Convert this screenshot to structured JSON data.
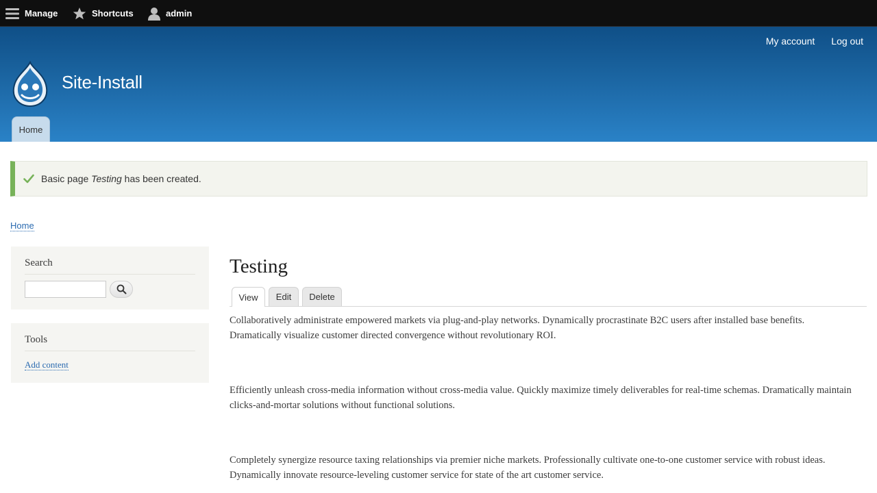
{
  "toolbar": {
    "manage": "Manage",
    "shortcuts": "Shortcuts",
    "user": "admin"
  },
  "header": {
    "secondary_menu": [
      "My account",
      "Log out"
    ],
    "site_name": "Site-Install",
    "main_tab": "Home",
    "brand_color": "#2a82c7"
  },
  "status": {
    "prefix": "Basic page ",
    "title": "Testing",
    "suffix": " has been created.",
    "accent_color": "#77b259"
  },
  "breadcrumb": "Home",
  "sidebar": {
    "search_title": "Search",
    "search_value": "",
    "tools_title": "Tools",
    "tools_link": "Add content"
  },
  "main": {
    "title": "Testing",
    "tabs": [
      "View",
      "Edit",
      "Delete"
    ],
    "paragraphs": [
      "Collaboratively administrate empowered markets via plug-and-play networks. Dynamically procrastinate B2C users after installed base benefits. Dramatically visualize customer directed convergence without revolutionary ROI.",
      "Efficiently unleash cross-media information without cross-media value. Quickly maximize timely deliverables for real-time schemas. Dramatically maintain clicks-and-mortar solutions without functional solutions.",
      "Completely synergize resource taxing relationships via premier niche markets. Professionally cultivate one-to-one customer service with robust ideas. Dynamically innovate resource-leveling customer service for state of the art customer service."
    ]
  }
}
